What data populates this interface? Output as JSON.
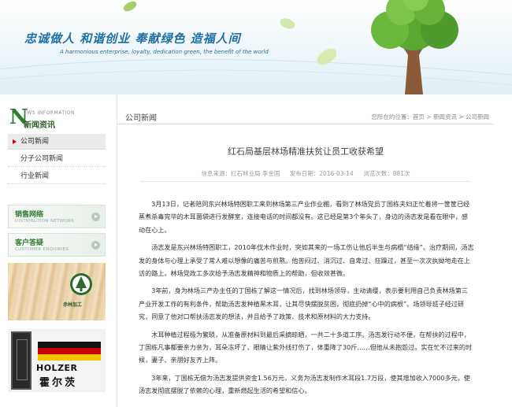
{
  "header": {
    "slogan": "忠诚做人  和谐创业  奉献绿色  造福人间",
    "slogan_en": "A harmonious enterprise, loyalty, dedication green, the benefit of the world"
  },
  "sidebar": {
    "news_letter": "N",
    "news_en": "EWS INFORMATION",
    "news_cn": "新闻资讯",
    "menu": [
      {
        "label": "公司新闻",
        "active": true
      },
      {
        "label": "分子公司新闻",
        "active": false
      },
      {
        "label": "行业新闻",
        "active": false
      }
    ],
    "distribution": {
      "title": "销售网络",
      "subtitle": "DISTRIBUTION NETWORK"
    },
    "enquiries": {
      "title": "客户答疑",
      "subtitle": "CUSTOMER ENQUIRIES"
    },
    "ad1_text": "赤林加工",
    "ad2_brand": "HOLZER",
    "ad2_brand_cn": "霍尔茨"
  },
  "main": {
    "section_title": "公司新闻",
    "breadcrumb": "您所在的位置：首页 > 新闻资讯 > 公司新闻",
    "article": {
      "title": "红石局基层林场精准扶贫让员工收获希望",
      "source": "信息来源：红石林业局 李金国",
      "date": "发布日期：2016-03-14",
      "views": "浏览次数：881次",
      "paragraphs": [
        "3月13日，记者陪同东兴林场特困职工来到林场第三产业作业棚，看到了林场党员丁国栋夫妇正忙着将一筐筐已经蒸煮杀毒完毕的木耳菌袋进行发酵室，连接电话的时间都没有。这已经是第3个年头了，身边的汤志发是看在眼中，感动在心上。",
        "汤志发是东兴林场特困职工，2010年伐木作业时，突如其来的一场工伤让他后半生与病榻“结缘”。治疗期间，汤志发的身体与心理上承受了常人难以想像的痛苦与煎熬。他苦闷过、消沉过、自卑过、狂躁过，甚至一次次执拗地走在上访的路上。林场党政工多次给予汤志发精神和物质上的帮助，但收效甚微。",
        "3年前，身为林场三产办主任的丁国栋了解这一情况后，找到林场领导，主动请缨，表示要利用自己负责林场第三产业开发工作的有利条件，帮助汤志发种植黑木耳，让其尽快摆脱贫困，彻底扔掉“心中的病根”。场领导班子经过研究，同意了他对口帮扶汤志发的想法，并且给予了政策、技术和原材料的大力支持。",
        "木耳种植过程极为繁琐，从准备原材料到最后采摘晾晒，一共二十多道工序。汤志发行动不便，在帮扶的过程中，丁国栋凡事都要亲力亲为，耳朵冻坏了、眼睛让紫外线打伤了，体重降了30斤……但他从未抱怨过。实在忙不过来的时候，妻子、亲朋好友齐上阵。",
        "3年来，丁国栋无偿为汤志发提供资金1.56万元，义务为汤志发制作木耳段1.7万段，使其增加收入7000多元，使汤志发彻底摆脱了依赖的心理，重新燃起生活的希望和信心。"
      ]
    }
  },
  "colors": {
    "slogan": "#1f6fa3",
    "accent_green": "#2e7d32",
    "active_arrow": "#cc0000"
  }
}
